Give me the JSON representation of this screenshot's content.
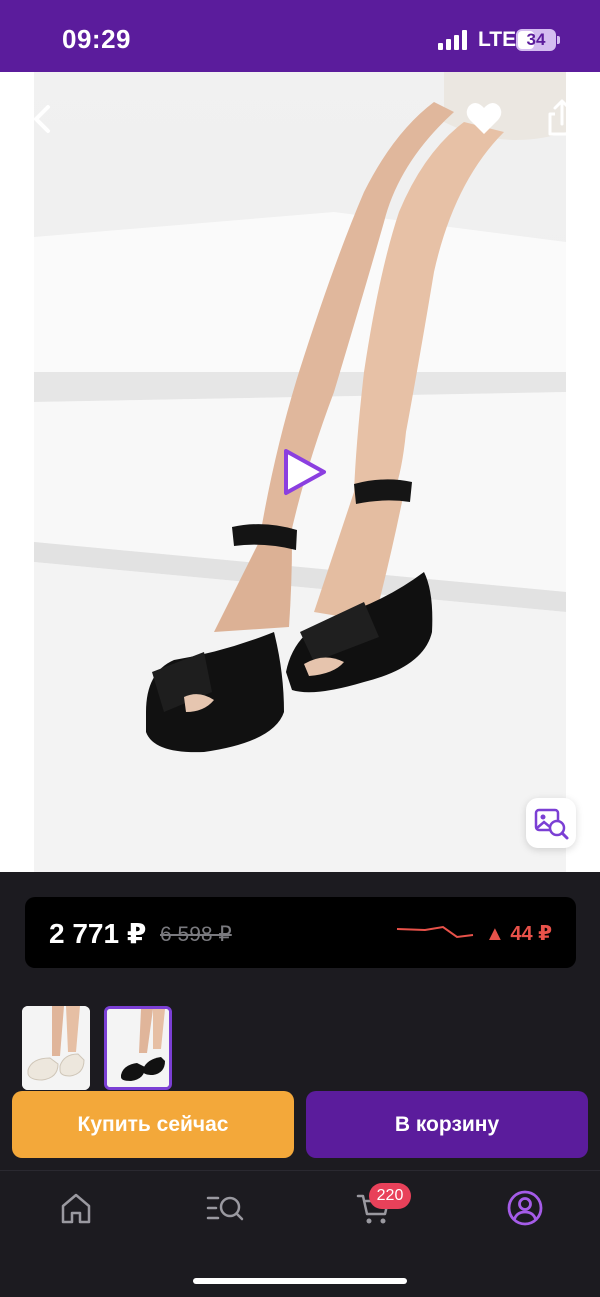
{
  "status_bar": {
    "time": "09:29",
    "network": "LTE",
    "battery": "34"
  },
  "product_gallery": {
    "icons": [
      "back-icon",
      "heart-icon",
      "share-icon",
      "play-icon",
      "visual-search-icon"
    ]
  },
  "price": {
    "current": "2 771 ₽",
    "old": "6 598 ₽",
    "change": "▲ 44 ₽"
  },
  "actions": {
    "buy_now": "Купить сейчас",
    "add_to_cart": "В корзину"
  },
  "tabbar": {
    "cart_count": "220",
    "icons": [
      "home-icon",
      "catalog-search-icon",
      "cart-icon",
      "profile-icon"
    ]
  },
  "colors": {
    "brand": "#5b1c9c",
    "buy_now": "#f3a83a",
    "price_down": "#e8524a",
    "badge": "#e8415a"
  }
}
